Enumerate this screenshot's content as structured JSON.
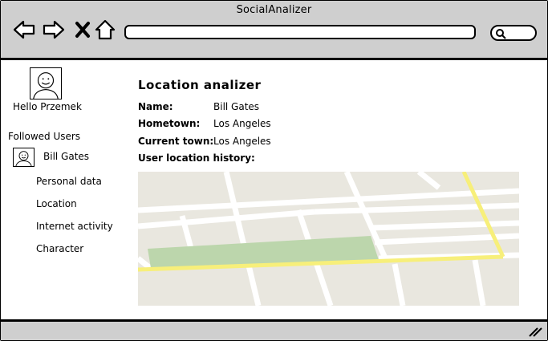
{
  "window": {
    "title": "SocialAnalizer"
  },
  "toolbar": {
    "back_icon": "arrow-left-icon",
    "forward_icon": "arrow-right-icon",
    "close_icon": "close-icon",
    "home_icon": "home-icon",
    "address_value": "",
    "search_icon": "search-icon"
  },
  "sidebar": {
    "greeting": "Hello Przemek",
    "followed_heading": "Followed Users",
    "followed_user": "Bill Gates",
    "menu": [
      "Personal data",
      "Location",
      "Internet activity",
      "Character"
    ]
  },
  "main": {
    "title": "Location analizer",
    "fields": [
      {
        "label": "Name:",
        "value": "Bill Gates"
      },
      {
        "label": "Hometown:",
        "value": "Los Angeles"
      },
      {
        "label": "Current town:",
        "value": "Los Angeles"
      }
    ],
    "history_label": "User location history:"
  },
  "colors": {
    "chrome": "#cfcfcf",
    "map_bg": "#e9e7df",
    "map_road": "#ffffff",
    "map_highway": "#f7ef7a",
    "map_park": "#bcd6ac"
  }
}
